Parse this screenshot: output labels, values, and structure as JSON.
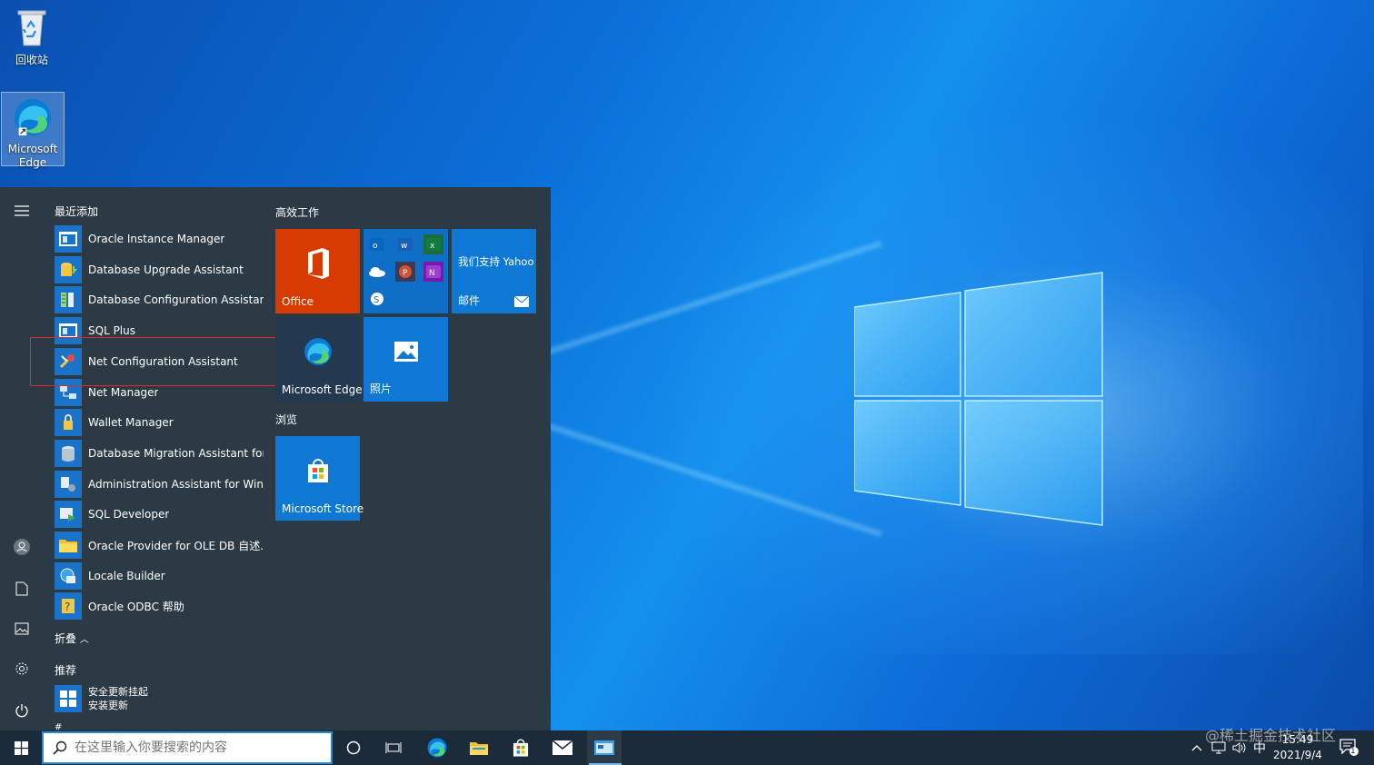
{
  "desktop": {
    "icons": [
      {
        "label": "回收站"
      },
      {
        "label": "Microsoft Edge"
      }
    ]
  },
  "start_menu": {
    "recent_header": "最近添加",
    "apps": [
      {
        "label": "Oracle Instance Manager",
        "icon": "window-icon"
      },
      {
        "label": "Database Upgrade Assistant",
        "icon": "db-upgrade-icon"
      },
      {
        "label": "Database Configuration Assistant",
        "icon": "db-config-icon"
      },
      {
        "label": "SQL Plus",
        "icon": "window-icon"
      },
      {
        "label": "Net Configuration Assistant",
        "icon": "net-config-icon"
      },
      {
        "label": "Net Manager",
        "icon": "net-manager-icon"
      },
      {
        "label": "Wallet Manager",
        "icon": "wallet-icon"
      },
      {
        "label": "Database Migration Assistant for...",
        "icon": "db-migration-icon"
      },
      {
        "label": "Administration Assistant for Win...",
        "icon": "admin-icon"
      },
      {
        "label": "SQL Developer",
        "icon": "sql-developer-icon"
      },
      {
        "label": "Oracle Provider for OLE DB 自述...",
        "icon": "folder-icon"
      },
      {
        "label": "Locale Builder",
        "icon": "locale-icon"
      },
      {
        "label": "Oracle ODBC 帮助",
        "icon": "help-icon"
      }
    ],
    "collapse_label": "折叠",
    "recommended_header": "推荐",
    "recommended_item": {
      "line1": "安全更新挂起",
      "line2": "安装更新"
    },
    "next_section_letter": "#",
    "tiles_header_productivity": "高效工作",
    "tiles_header_browse": "浏览",
    "tiles": {
      "office": "Office",
      "yahoo_title": "我们支持 Yahoo",
      "mail": "邮件",
      "edge": "Microsoft Edge",
      "photos": "照片",
      "store": "Microsoft Store"
    }
  },
  "taskbar": {
    "search_placeholder": "在这里输入你要搜索的内容",
    "ime": "中",
    "time": "15:49",
    "date": "2021/9/4",
    "notification_count": "1"
  },
  "watermark": "@稀土掘金技术社区",
  "colors": {
    "start_bg": "#2b3a45",
    "accent": "#0078d7",
    "office_tile": "#d83b01",
    "taskbar": "#1c2b3a",
    "highlight_box": "#e02b2b"
  }
}
